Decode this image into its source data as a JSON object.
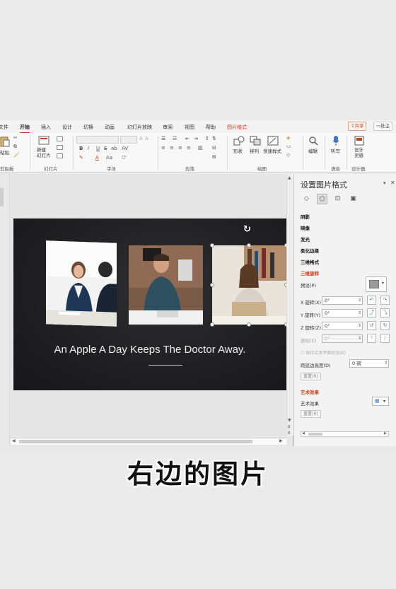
{
  "menu": {
    "tabs": [
      "文件",
      "开始",
      "插入",
      "设计",
      "切换",
      "动画",
      "幻灯片放映",
      "审阅",
      "视图",
      "帮助",
      "图片格式"
    ],
    "active": "开始",
    "share_label": "共享",
    "comment_label": "批注"
  },
  "ribbon": {
    "groups": {
      "clipboard": "剪贴板",
      "slides": "幻灯片",
      "font": "字体",
      "paragraph": "段落",
      "drawing": "绘图",
      "voice": "语音",
      "designer": "设计器"
    },
    "buttons": {
      "paste": "粘贴",
      "new_slide": "新建\n幻灯片",
      "shapes": "形状",
      "arrange": "排列",
      "quick_styles": "快速样式",
      "edit": "编辑",
      "dictate": "听写",
      "design_ideas": "设计\n灵感"
    },
    "font_controls": [
      "B",
      "I",
      "U",
      "S",
      "ab",
      "AV",
      "A",
      "Aa"
    ]
  },
  "slide": {
    "caption": "An Apple A Day Keeps The Doctor Away."
  },
  "pane": {
    "title": "设置图片格式",
    "sections": [
      "阴影",
      "映像",
      "发光",
      "柔化边缘",
      "三维格式",
      "三维旋转"
    ],
    "preset_label": "预设(P)",
    "x_rotation": {
      "label": "X 旋转(X)",
      "value": "0°"
    },
    "y_rotation": {
      "label": "Y 旋转(Y)",
      "value": "0°"
    },
    "z_rotation": {
      "label": "Z 旋转(Z)",
      "value": "0°"
    },
    "perspective": {
      "label": "透视(E)",
      "value": "0°"
    },
    "keep_flat": "保持文本平面状态(K)",
    "distance_label": "距底边高度(D)",
    "distance_value": "0 磅",
    "reset_label": "重置(R)",
    "artistic_section": "艺术效果",
    "artistic_label": "艺术效果",
    "reset2_label": "重置(R)"
  },
  "subtitle": "右边的图片",
  "colors": {
    "accent": "#c43e1c",
    "slide_bg": "#1f1f21"
  }
}
